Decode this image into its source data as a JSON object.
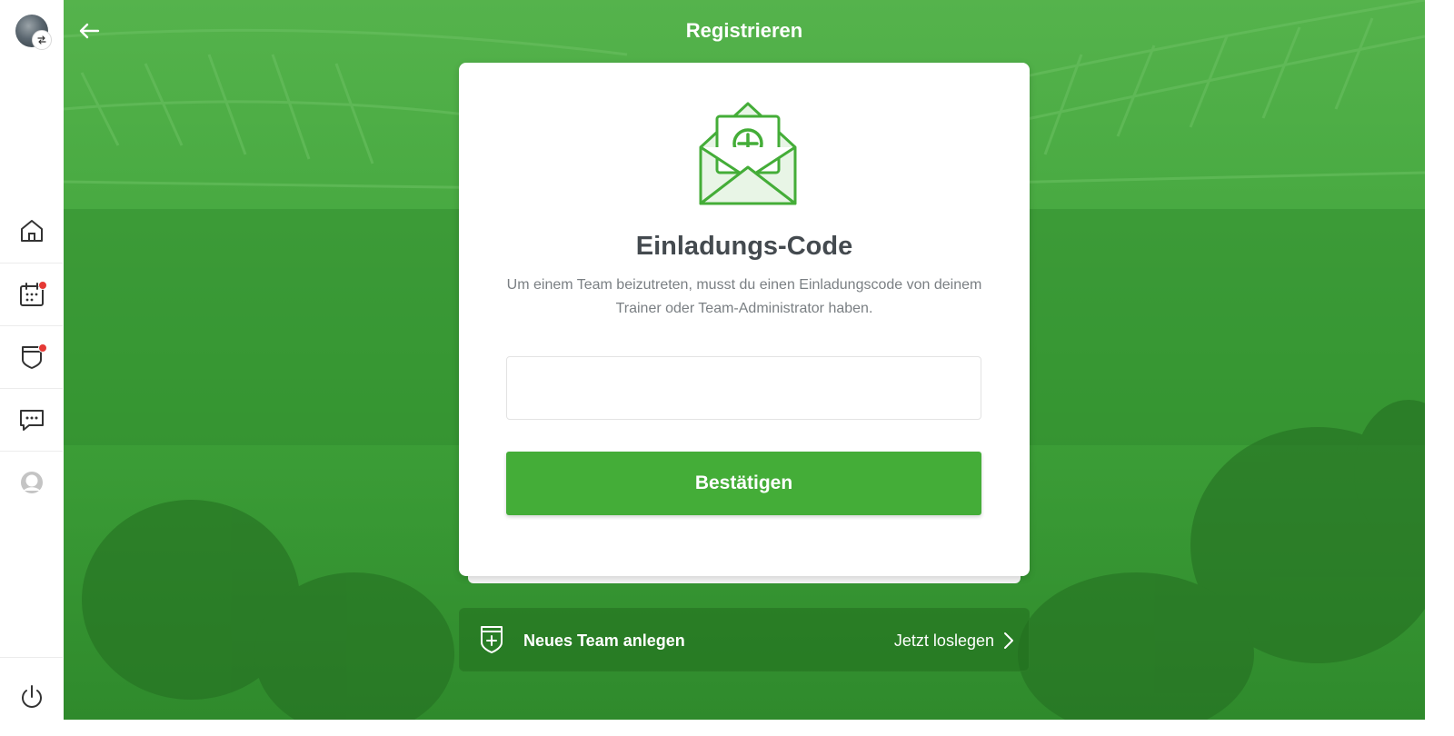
{
  "header": {
    "title": "Registrieren"
  },
  "sidebar": {
    "items": [
      {
        "name": "home",
        "icon": "home-icon",
        "badge": false
      },
      {
        "name": "calendar",
        "icon": "calendar-icon",
        "badge": true
      },
      {
        "name": "team",
        "icon": "shield-icon",
        "badge": true
      },
      {
        "name": "messages",
        "icon": "chat-icon",
        "badge": false
      },
      {
        "name": "profile",
        "icon": "user-icon",
        "badge": false
      }
    ],
    "logout_icon": "power-icon",
    "badge_color": "#e53935"
  },
  "card": {
    "title": "Einladungs-Code",
    "description": "Um einem Team beizutreten, musst du einen Einladungscode von deinem Trainer oder Team-Administrator haben.",
    "input": {
      "value": "",
      "placeholder": ""
    },
    "confirm_label": "Bestätigen"
  },
  "new_team": {
    "label": "Neues Team anlegen",
    "cta": "Jetzt loslegen"
  },
  "colors": {
    "brand_green": "#44ad38",
    "background_green": "#3fa33a",
    "text_dark": "#444a4f",
    "text_muted": "#7a7f83"
  }
}
